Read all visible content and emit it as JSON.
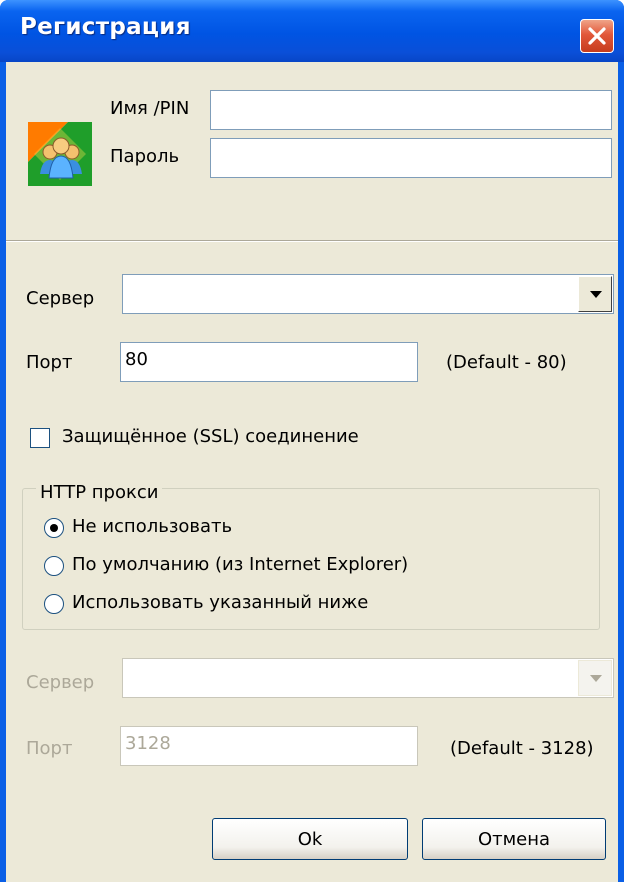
{
  "window": {
    "title": "Регистрация",
    "close_icon": "close-icon"
  },
  "login": {
    "name_label": "Имя /PIN",
    "name_value": "",
    "password_label": "Пароль",
    "password_value": "",
    "icon": "users-icon"
  },
  "server": {
    "label": "Сервер",
    "value": "",
    "port_label": "Порт",
    "port_value": "80",
    "port_default": "(Default - 80)",
    "ssl_label": "Защищённое (SSL) соединение",
    "ssl_checked": false
  },
  "proxy": {
    "group_title": "HTTP прокси",
    "options": [
      {
        "label": "Не использовать",
        "selected": true
      },
      {
        "label": "По умолчанию (из Internet Explorer)",
        "selected": false
      },
      {
        "label": "Использовать указанный ниже",
        "selected": false
      }
    ],
    "server_label": "Сервер",
    "server_value": "",
    "port_label": "Порт",
    "port_value": "3128",
    "port_default": "(Default - 3128)"
  },
  "buttons": {
    "ok": "Ok",
    "cancel": "Отмена"
  },
  "colors": {
    "titlebar": "#0054e3",
    "dialog_bg": "#ece9d8",
    "close": "#e2583a",
    "radio_dot": "#21a121"
  }
}
